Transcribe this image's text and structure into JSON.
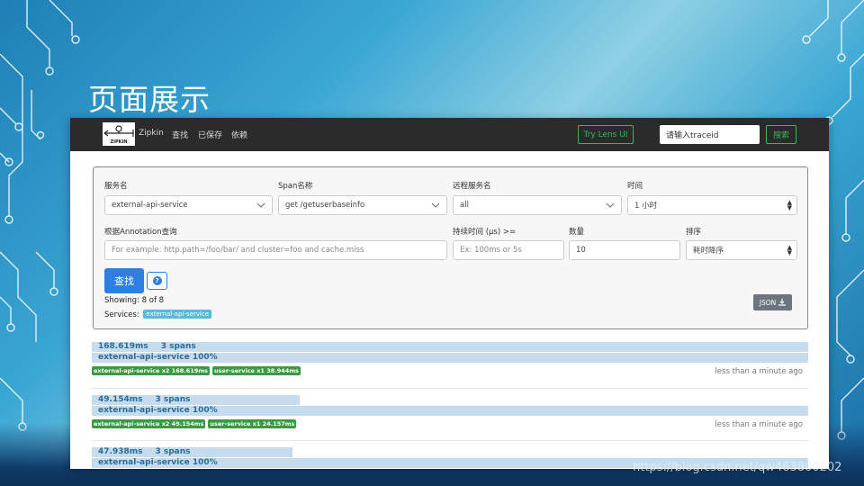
{
  "slide": {
    "title": "页面展示",
    "watermark": "https://blog.csdn.net/qw463800202"
  },
  "navbar": {
    "brand": "Zipkin",
    "logo_text": "ZIPKIN",
    "links": [
      "查找",
      "已保存",
      "依赖"
    ],
    "lens_button": "Try Lens UI",
    "traceid_placeholder": "请输入traceid",
    "search_button": "搜索"
  },
  "search_form": {
    "service_label": "服务名",
    "service_value": "external-api-service",
    "span_label": "Span名称",
    "span_value": "get /getuserbaseinfo",
    "remote_label": "远程服务名",
    "remote_value": "all",
    "time_label": "时间",
    "time_value": "1 小时",
    "annotation_label": "根据Annotation查询",
    "annotation_placeholder": "For example: http.path=/foo/bar/ and cluster=foo and cache.miss",
    "duration_label": "持续时间 (μs) >=",
    "duration_placeholder": "Ex: 100ms or 5s",
    "limit_label": "数量",
    "limit_value": "10",
    "sort_label": "排序",
    "sort_value": "耗时降序",
    "find_button": "查找",
    "help_icon": "?",
    "showing": "Showing: 8 of 8",
    "services_label": "Services:",
    "services_badge": "external-api-service",
    "json_button": "JSON"
  },
  "traces": [
    {
      "duration": "168.619ms",
      "spans": "3 spans",
      "bar_fraction": 1.0,
      "service_pct": "external-api-service 100%",
      "tags": [
        "external-api-service x2 168.619ms",
        "user-service x1 38.944ms"
      ],
      "ago": "less than a minute ago"
    },
    {
      "duration": "49.154ms",
      "spans": "3 spans",
      "bar_fraction": 0.29,
      "service_pct": "external-api-service 100%",
      "tags": [
        "external-api-service x2 49.154ms",
        "user-service x1 24.157ms"
      ],
      "ago": "less than a minute ago"
    },
    {
      "duration": "47.938ms",
      "spans": "3 spans",
      "bar_fraction": 0.28,
      "service_pct": "external-api-service 100%",
      "tags": [],
      "ago": ""
    }
  ],
  "colors": {
    "navbar": "#2b2b2b",
    "accent_green": "#3fb25a",
    "primary_blue": "#2f7fe3",
    "trace_bar": "#c4dced",
    "tag_green": "#3a9a42",
    "badge_blue": "#5bb8d6"
  }
}
